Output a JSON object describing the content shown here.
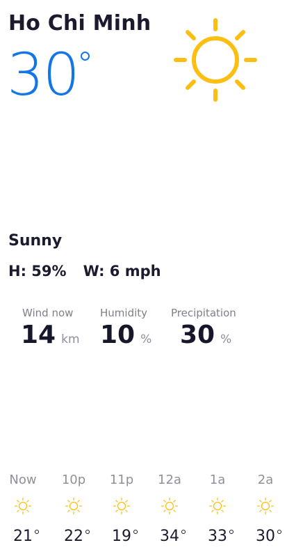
{
  "location": {
    "city": "Ho Chi Minh"
  },
  "current": {
    "temperature": "30",
    "condition": "Sunny",
    "humidity_short": "H: 59%",
    "wind_short": "W: 6 mph",
    "icon": "sun-icon"
  },
  "stats": [
    {
      "label": "Wind now",
      "value": "14",
      "unit": "km"
    },
    {
      "label": "Humidity",
      "value": "10",
      "unit": "%"
    },
    {
      "label": "Precipitation",
      "value": "30",
      "unit": "%"
    }
  ],
  "hourly": [
    {
      "time": "Now",
      "temp": "21",
      "icon": "sun-icon"
    },
    {
      "time": "10p",
      "temp": "22",
      "icon": "sun-icon"
    },
    {
      "time": "11p",
      "temp": "19",
      "icon": "sun-icon"
    },
    {
      "time": "12a",
      "temp": "34",
      "icon": "sun-icon"
    },
    {
      "time": "1a",
      "temp": "33",
      "icon": "sun-icon"
    },
    {
      "time": "2a",
      "temp": "30",
      "icon": "sun-icon"
    }
  ],
  "colors": {
    "accent": "#1476e6",
    "sun": "#fbbf14",
    "text": "#1a1b2e",
    "muted": "#7d7f8c"
  }
}
